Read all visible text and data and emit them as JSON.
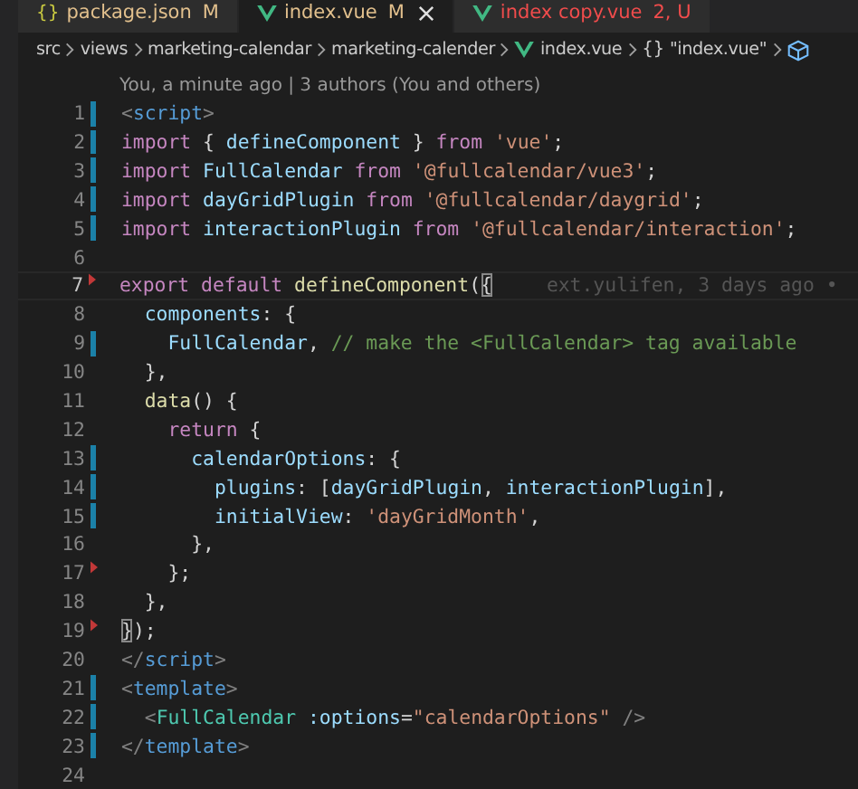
{
  "tabs": [
    {
      "kind": "json",
      "glyph": "{}",
      "label": "package.json",
      "badge": "M",
      "color": "#e2c08d",
      "selected": false,
      "closable": false
    },
    {
      "kind": "vue",
      "label": "index.vue",
      "badge": "M",
      "color": "#e2c08d",
      "selected": true,
      "closable": true
    },
    {
      "kind": "vue",
      "label": "index copy.vue",
      "badge": "2, U",
      "color": "#f14c4c",
      "selected": false,
      "closable": false
    }
  ],
  "breadcrumb": [
    {
      "kind": "folder",
      "label": "src"
    },
    {
      "kind": "folder",
      "label": "views"
    },
    {
      "kind": "folder",
      "label": "marketing-calendar"
    },
    {
      "kind": "folder",
      "label": "marketing-calender"
    },
    {
      "kind": "vue",
      "label": "index.vue"
    },
    {
      "kind": "braces",
      "glyph": "{}",
      "label": "\"index.vue\""
    },
    {
      "kind": "cube"
    }
  ],
  "codelens": "You, a minute ago | 3 authors (You and others)",
  "editor": {
    "lines": [
      {
        "number": "1",
        "modified": true,
        "deleted": false,
        "current": false,
        "tokens": [
          {
            "kind": "punct",
            "text": "<"
          },
          {
            "kind": "tag",
            "text": "script"
          },
          {
            "kind": "punct",
            "text": ">"
          }
        ]
      },
      {
        "number": "2",
        "modified": true,
        "deleted": false,
        "current": false,
        "tokens": [
          {
            "kind": "keyword",
            "text": "import"
          },
          {
            "kind": "plain",
            "text": " { "
          },
          {
            "kind": "ident",
            "text": "defineComponent"
          },
          {
            "kind": "plain",
            "text": " } "
          },
          {
            "kind": "keyword",
            "text": "from "
          },
          {
            "kind": "string",
            "text": "'vue'"
          },
          {
            "kind": "plain",
            "text": ";"
          }
        ]
      },
      {
        "number": "3",
        "modified": true,
        "deleted": false,
        "current": false,
        "tokens": [
          {
            "kind": "keyword",
            "text": "import "
          },
          {
            "kind": "ident",
            "text": "FullCalendar "
          },
          {
            "kind": "keyword",
            "text": "from "
          },
          {
            "kind": "string",
            "text": "'@fullcalendar/vue3'"
          },
          {
            "kind": "plain",
            "text": ";"
          }
        ]
      },
      {
        "number": "4",
        "modified": true,
        "deleted": false,
        "current": false,
        "tokens": [
          {
            "kind": "keyword",
            "text": "import "
          },
          {
            "kind": "ident",
            "text": "dayGridPlugin "
          },
          {
            "kind": "keyword",
            "text": "from "
          },
          {
            "kind": "string",
            "text": "'@fullcalendar/daygrid'"
          },
          {
            "kind": "plain",
            "text": ";"
          }
        ]
      },
      {
        "number": "5",
        "modified": true,
        "deleted": false,
        "current": false,
        "tokens": [
          {
            "kind": "keyword",
            "text": "import "
          },
          {
            "kind": "ident",
            "text": "interactionPlugin "
          },
          {
            "kind": "keyword",
            "text": "from "
          },
          {
            "kind": "string",
            "text": "'@fullcalendar/interaction'"
          },
          {
            "kind": "plain",
            "text": ";"
          }
        ]
      },
      {
        "number": "6",
        "modified": false,
        "deleted": false,
        "current": false
      },
      {
        "number": "7",
        "modified": false,
        "deleted": true,
        "current": true,
        "blame": "ext.yulifen, 3 days ago •",
        "tokens": [
          {
            "kind": "keyword",
            "text": "export default "
          },
          {
            "kind": "func",
            "text": "defineComponent"
          },
          {
            "kind": "plain",
            "text": "("
          },
          {
            "kind": "match",
            "text": "{"
          }
        ]
      },
      {
        "number": "8",
        "modified": false,
        "deleted": false,
        "current": false,
        "tokens": [
          {
            "kind": "ident",
            "text": "  components"
          },
          {
            "kind": "plain",
            "text": ": {"
          }
        ]
      },
      {
        "number": "9",
        "modified": true,
        "deleted": false,
        "current": false,
        "tokens": [
          {
            "kind": "ident",
            "text": "    FullCalendar"
          },
          {
            "kind": "plain",
            "text": ","
          },
          {
            "kind": "comment",
            "text": " // make the <FullCalendar> tag available"
          }
        ]
      },
      {
        "number": "10",
        "modified": false,
        "deleted": false,
        "current": false,
        "tokens": [
          {
            "kind": "plain",
            "text": "  },"
          }
        ]
      },
      {
        "number": "11",
        "modified": false,
        "deleted": false,
        "current": false,
        "tokens": [
          {
            "kind": "func",
            "text": "  data"
          },
          {
            "kind": "plain",
            "text": "() {"
          }
        ]
      },
      {
        "number": "12",
        "modified": false,
        "deleted": false,
        "current": false,
        "tokens": [
          {
            "kind": "keyword",
            "text": "    return"
          },
          {
            "kind": "plain",
            "text": " {"
          }
        ]
      },
      {
        "number": "13",
        "modified": true,
        "deleted": false,
        "current": false,
        "tokens": [
          {
            "kind": "ident",
            "text": "      calendarOptions"
          },
          {
            "kind": "plain",
            "text": ": {"
          }
        ]
      },
      {
        "number": "14",
        "modified": true,
        "deleted": false,
        "current": false,
        "tokens": [
          {
            "kind": "ident",
            "text": "        plugins"
          },
          {
            "kind": "plain",
            "text": ": ["
          },
          {
            "kind": "ident",
            "text": "dayGridPlugin"
          },
          {
            "kind": "plain",
            "text": ","
          },
          {
            "kind": "ident",
            "text": " interactionPlugin"
          },
          {
            "kind": "plain",
            "text": "],"
          }
        ]
      },
      {
        "number": "15",
        "modified": true,
        "deleted": false,
        "current": false,
        "tokens": [
          {
            "kind": "ident",
            "text": "        initialView"
          },
          {
            "kind": "plain",
            "text": ":"
          },
          {
            "kind": "string",
            "text": " 'dayGridMonth'"
          },
          {
            "kind": "plain",
            "text": ","
          }
        ]
      },
      {
        "number": "16",
        "modified": false,
        "deleted": false,
        "current": false,
        "tokens": [
          {
            "kind": "plain",
            "text": "      },"
          }
        ]
      },
      {
        "number": "17",
        "modified": false,
        "deleted": true,
        "current": false,
        "tokens": [
          {
            "kind": "plain",
            "text": "    };"
          }
        ]
      },
      {
        "number": "18",
        "modified": false,
        "deleted": false,
        "current": false,
        "tokens": [
          {
            "kind": "plain",
            "text": "  },"
          }
        ]
      },
      {
        "number": "19",
        "modified": false,
        "deleted": true,
        "current": false,
        "tokens": [
          {
            "kind": "match",
            "text": "}"
          },
          {
            "kind": "plain",
            "text": ");"
          }
        ]
      },
      {
        "number": "20",
        "modified": false,
        "deleted": false,
        "current": false,
        "tokens": [
          {
            "kind": "punct",
            "text": "</"
          },
          {
            "kind": "tag",
            "text": "script"
          },
          {
            "kind": "punct",
            "text": ">"
          }
        ]
      },
      {
        "number": "21",
        "modified": true,
        "deleted": false,
        "current": false,
        "tokens": [
          {
            "kind": "punct",
            "text": "<"
          },
          {
            "kind": "tag",
            "text": "template"
          },
          {
            "kind": "punct",
            "text": ">"
          }
        ]
      },
      {
        "number": "22",
        "modified": true,
        "deleted": false,
        "current": false,
        "tokens": [
          {
            "kind": "punct",
            "text": "  <"
          },
          {
            "kind": "component",
            "text": "FullCalendar"
          },
          {
            "kind": "ident",
            "text": " :options"
          },
          {
            "kind": "plain",
            "text": "="
          },
          {
            "kind": "string",
            "text": "\"calendarOptions\""
          },
          {
            "kind": "punct",
            "text": " />"
          }
        ]
      },
      {
        "number": "23",
        "modified": true,
        "deleted": false,
        "current": false,
        "tokens": [
          {
            "kind": "punct",
            "text": "</"
          },
          {
            "kind": "tag",
            "text": "template"
          },
          {
            "kind": "punct",
            "text": ">"
          }
        ]
      },
      {
        "number": "24",
        "modified": false,
        "deleted": false,
        "current": false
      }
    ]
  }
}
